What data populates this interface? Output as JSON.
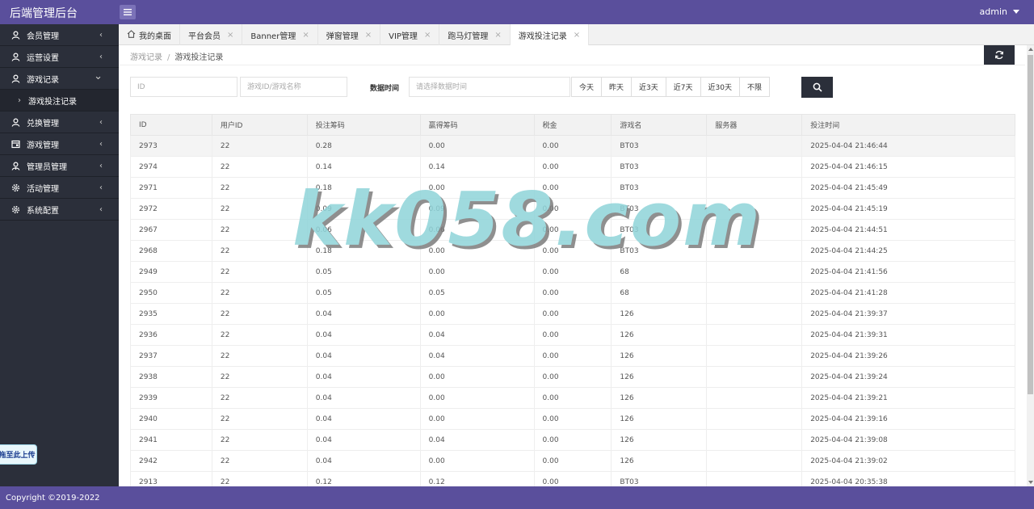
{
  "header": {
    "brand": "后端管理后台",
    "user": "admin"
  },
  "sidebar": {
    "items": [
      {
        "label": "会员管理",
        "icon": "user-icon"
      },
      {
        "label": "运营设置",
        "icon": "user-icon"
      },
      {
        "label": "游戏记录",
        "icon": "user-icon",
        "expanded": true
      },
      {
        "label": "兑换管理",
        "icon": "user-icon"
      },
      {
        "label": "游戏管理",
        "icon": "game-icon"
      },
      {
        "label": "管理员管理",
        "icon": "admin-icon"
      },
      {
        "label": "活动管理",
        "icon": "gear-icon"
      },
      {
        "label": "系统配置",
        "icon": "gear-icon"
      }
    ],
    "sub_item": "游戏投注记录",
    "upload_label": "拖至此上传"
  },
  "tabs": [
    {
      "label": "我的桌面",
      "icon": "home-icon",
      "closable": false
    },
    {
      "label": "平台会员",
      "closable": true
    },
    {
      "label": "Banner管理",
      "closable": true
    },
    {
      "label": "弹窗管理",
      "closable": true
    },
    {
      "label": "VIP管理",
      "closable": true
    },
    {
      "label": "跑马灯管理",
      "closable": true
    },
    {
      "label": "游戏投注记录",
      "closable": true,
      "active": true
    }
  ],
  "breadcrumb": {
    "parent": "游戏记录",
    "separator": "/",
    "current": "游戏投注记录"
  },
  "filters": {
    "id_placeholder": "ID",
    "game_placeholder": "游戏ID/游戏名称",
    "time_label": "数据时间",
    "time_placeholder": "请选择数据时间",
    "quick_buttons": [
      "今天",
      "昨天",
      "近3天",
      "近7天",
      "近30天",
      "不限"
    ]
  },
  "table": {
    "columns": [
      "ID",
      "用户ID",
      "投注筹码",
      "赢得筹码",
      "税金",
      "游戏名",
      "服务器",
      "投注时间"
    ],
    "rows": [
      [
        "2973",
        "22",
        "0.28",
        "0.00",
        "0.00",
        "BT03",
        "",
        "2025-04-04 21:46:44"
      ],
      [
        "2974",
        "22",
        "0.14",
        "0.14",
        "0.00",
        "BT03",
        "",
        "2025-04-04 21:46:15"
      ],
      [
        "2971",
        "22",
        "0.18",
        "0.00",
        "0.00",
        "BT03",
        "",
        "2025-04-04 21:45:49"
      ],
      [
        "2972",
        "22",
        "0.09",
        "0.09",
        "0.00",
        "BT03",
        "",
        "2025-04-04 21:45:19"
      ],
      [
        "2967",
        "22",
        "0.06",
        "0.06",
        "0.00",
        "BT03",
        "",
        "2025-04-04 21:44:51"
      ],
      [
        "2968",
        "22",
        "0.18",
        "0.00",
        "0.00",
        "BT03",
        "",
        "2025-04-04 21:44:25"
      ],
      [
        "2949",
        "22",
        "0.05",
        "0.00",
        "0.00",
        "68",
        "",
        "2025-04-04 21:41:56"
      ],
      [
        "2950",
        "22",
        "0.05",
        "0.05",
        "0.00",
        "68",
        "",
        "2025-04-04 21:41:28"
      ],
      [
        "2935",
        "22",
        "0.04",
        "0.00",
        "0.00",
        "126",
        "",
        "2025-04-04 21:39:37"
      ],
      [
        "2936",
        "22",
        "0.04",
        "0.04",
        "0.00",
        "126",
        "",
        "2025-04-04 21:39:31"
      ],
      [
        "2937",
        "22",
        "0.04",
        "0.04",
        "0.00",
        "126",
        "",
        "2025-04-04 21:39:26"
      ],
      [
        "2938",
        "22",
        "0.04",
        "0.00",
        "0.00",
        "126",
        "",
        "2025-04-04 21:39:24"
      ],
      [
        "2939",
        "22",
        "0.04",
        "0.00",
        "0.00",
        "126",
        "",
        "2025-04-04 21:39:21"
      ],
      [
        "2940",
        "22",
        "0.04",
        "0.00",
        "0.00",
        "126",
        "",
        "2025-04-04 21:39:16"
      ],
      [
        "2941",
        "22",
        "0.04",
        "0.04",
        "0.00",
        "126",
        "",
        "2025-04-04 21:39:08"
      ],
      [
        "2942",
        "22",
        "0.04",
        "0.00",
        "0.00",
        "126",
        "",
        "2025-04-04 21:39:02"
      ],
      [
        "2913",
        "22",
        "0.12",
        "0.12",
        "0.00",
        "BT03",
        "",
        "2025-04-04 20:35:38"
      ]
    ]
  },
  "watermark": "kk058.com",
  "footer": {
    "copyright": "Copyright ©2019-2022"
  },
  "colors": {
    "header": "#5a4f9c",
    "sidebar": "#2b2f3a",
    "dark_button": "#2b2f3a"
  }
}
